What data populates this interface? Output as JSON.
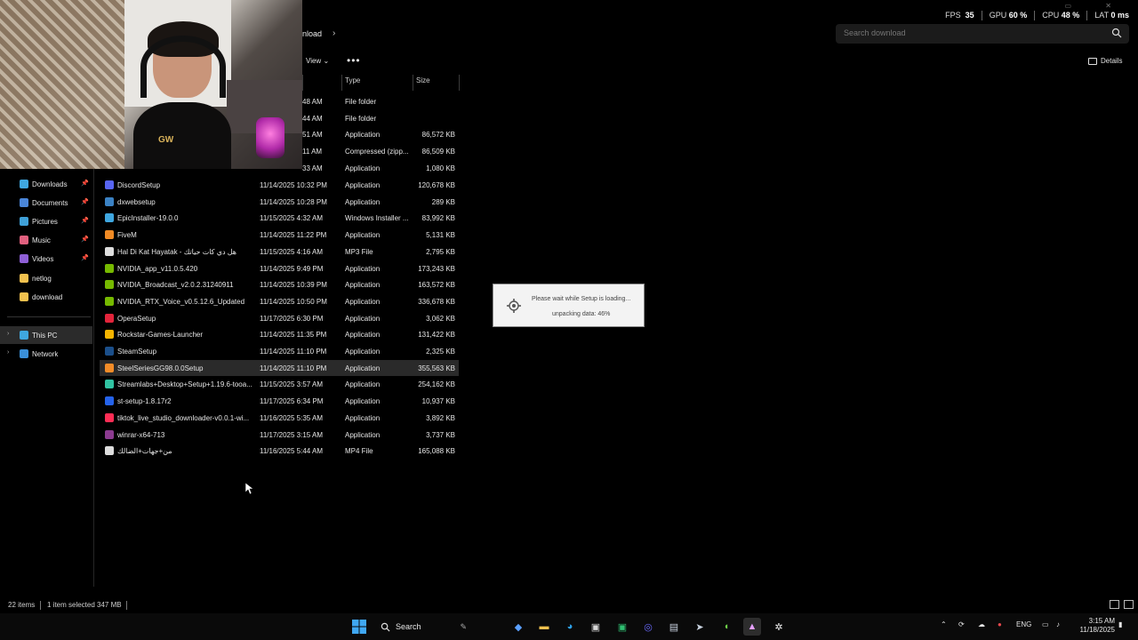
{
  "overlay": {
    "fps_label": "FPS",
    "fps_value": "35",
    "gpu_label": "GPU",
    "gpu_value": "60 %",
    "cpu_label": "CPU",
    "cpu_value": "48 %",
    "lat_label": "LAT",
    "lat_value": "0 ms"
  },
  "address": {
    "breadcrumb": "nload",
    "search_placeholder": "Search download"
  },
  "toolbar": {
    "view_label": "View",
    "more_label": "•••",
    "details_label": "Details"
  },
  "columns": {
    "type": "Type",
    "size": "Size"
  },
  "sidebar": {
    "quick": [
      {
        "label": "Downloads",
        "icon": "download-icon",
        "color": "#3fa7e0"
      },
      {
        "label": "Documents",
        "icon": "document-icon",
        "color": "#4a86d9"
      },
      {
        "label": "Pictures",
        "icon": "picture-icon",
        "color": "#3fa0d8"
      },
      {
        "label": "Music",
        "icon": "music-icon",
        "color": "#e0607e"
      },
      {
        "label": "Videos",
        "icon": "video-icon",
        "color": "#8e5fd6"
      },
      {
        "label": "netlog",
        "icon": "folder-icon",
        "color": "#f2c14e"
      },
      {
        "label": "download",
        "icon": "folder-icon",
        "color": "#f2c14e"
      }
    ],
    "this_pc": "This PC",
    "network": "Network"
  },
  "files_partial": [
    {
      "date": "48 AM",
      "type": "File folder",
      "size": ""
    },
    {
      "date": "44 AM",
      "type": "File folder",
      "size": ""
    },
    {
      "date": "51 AM",
      "type": "Application",
      "size": "86,572 KB"
    },
    {
      "date": "11 AM",
      "type": "Compressed (zipp...",
      "size": "86,509 KB"
    },
    {
      "date": "33 AM",
      "type": "Application",
      "size": "1,080 KB"
    }
  ],
  "files": [
    {
      "name": "DiscordSetup",
      "date": "11/14/2025 10:32 PM",
      "type": "Application",
      "size": "120,678 KB",
      "color": "#5865f2"
    },
    {
      "name": "dxwebsetup",
      "date": "11/14/2025 10:28 PM",
      "type": "Application",
      "size": "289 KB",
      "color": "#3b82c4"
    },
    {
      "name": "EpicInstaller-19.0.0",
      "date": "11/15/2025 4:32 AM",
      "type": "Windows Installer ...",
      "size": "83,992 KB",
      "color": "#3fa7e0"
    },
    {
      "name": "FiveM",
      "date": "11/14/2025 11:22 PM",
      "type": "Application",
      "size": "5,131 KB",
      "color": "#f08a24"
    },
    {
      "name": "Hal Di Kat Hayatak - هل دي كات حياتك",
      "date": "11/15/2025 4:16 AM",
      "type": "MP3 File",
      "size": "2,795 KB",
      "color": "#dddddd"
    },
    {
      "name": "NVIDIA_app_v11.0.5.420",
      "date": "11/14/2025 9:49 PM",
      "type": "Application",
      "size": "173,243 KB",
      "color": "#76b900"
    },
    {
      "name": "NVIDIA_Broadcast_v2.0.2.31240911",
      "date": "11/14/2025 10:39 PM",
      "type": "Application",
      "size": "163,572 KB",
      "color": "#76b900"
    },
    {
      "name": "NVIDIA_RTX_Voice_v0.5.12.6_Updated",
      "date": "11/14/2025 10:50 PM",
      "type": "Application",
      "size": "336,678 KB",
      "color": "#76b900"
    },
    {
      "name": "OperaSetup",
      "date": "11/17/2025 6:30 PM",
      "type": "Application",
      "size": "3,062 KB",
      "color": "#e3243b"
    },
    {
      "name": "Rockstar-Games-Launcher",
      "date": "11/14/2025 11:35 PM",
      "type": "Application",
      "size": "131,422 KB",
      "color": "#f4b400"
    },
    {
      "name": "SteamSetup",
      "date": "11/14/2025 11:10 PM",
      "type": "Application",
      "size": "2,325 KB",
      "color": "#1b4f8a"
    },
    {
      "name": "SteelSeriesGG98.0.0Setup",
      "date": "11/14/2025 11:10 PM",
      "type": "Application",
      "size": "355,563 KB",
      "color": "#f28c28"
    },
    {
      "name": "Streamlabs+Desktop+Setup+1.19.6-tooa...",
      "date": "11/15/2025 3:57 AM",
      "type": "Application",
      "size": "254,162 KB",
      "color": "#31c3a2"
    },
    {
      "name": "st-setup-1.8.17r2",
      "date": "11/17/2025 6:34 PM",
      "type": "Application",
      "size": "10,937 KB",
      "color": "#2563eb"
    },
    {
      "name": "tiktok_live_studio_downloader-v0.0.1-wi...",
      "date": "11/16/2025 5:35 AM",
      "type": "Application",
      "size": "3,892 KB",
      "color": "#ff2d55"
    },
    {
      "name": "winrar-x64-713",
      "date": "11/17/2025 3:15 AM",
      "type": "Application",
      "size": "3,737 KB",
      "color": "#8b3a8f"
    },
    {
      "name": "من+جهات+الضالك",
      "date": "11/16/2025 5:44 AM",
      "type": "MP4 File",
      "size": "165,088 KB",
      "color": "#dddddd"
    }
  ],
  "dialog": {
    "message": "Please wait while Setup is loading...",
    "progress": "unpacking data: 46%"
  },
  "status": {
    "items": "22 items",
    "selected": "1 item selected  347 MB"
  },
  "taskbar": {
    "search_label": "Search",
    "lang": "ENG",
    "time": "3:15 AM",
    "date": "11/18/2025"
  }
}
